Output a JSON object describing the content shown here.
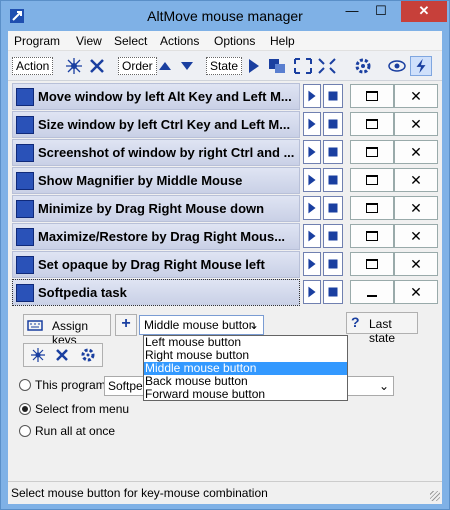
{
  "window": {
    "title": "AltMove mouse manager"
  },
  "menu": [
    "Program",
    "View",
    "Select",
    "Actions",
    "Options",
    "Help"
  ],
  "toolbar": {
    "action_label": "Action",
    "order_label": "Order",
    "state_label": "State"
  },
  "tasks": [
    {
      "label": "Move window by left Alt Key and Left M...",
      "icon": "move-window-icon"
    },
    {
      "label": "Size window by left Ctrl Key and Left M...",
      "icon": "size-window-icon"
    },
    {
      "label": "Screenshot of window by right Ctrl and ...",
      "icon": "screenshot-icon"
    },
    {
      "label": "Show Magnifier by Middle Mouse",
      "icon": "magnifier-icon"
    },
    {
      "label": "Minimize by Drag Right Mouse down",
      "icon": "minimize-icon"
    },
    {
      "label": "Maximize/Restore by Drag Right Mous...",
      "icon": "maximize-icon"
    },
    {
      "label": "Set opaque by Drag Right Mouse left",
      "icon": "eye-icon"
    },
    {
      "label": "Softpedia task",
      "icon": "window-icon"
    }
  ],
  "controls": {
    "assign_keys": "Assign keys",
    "last_state": "Last state",
    "mouse_button_selected": "Middle mouse button",
    "mouse_button_options": [
      "Left mouse button",
      "Right mouse button",
      "Middle mouse button",
      "Back mouse button",
      "Forward mouse button"
    ]
  },
  "radios": {
    "this_program": "This program",
    "select_from_menu": "Select from menu",
    "run_all": "Run all at once",
    "program_field_value": "Softpe"
  },
  "status": "Select mouse button for key-mouse combination",
  "colors": {
    "titlebar": "#7fb1e6",
    "close": "#c7403a",
    "selection": "#3399ff",
    "task_row": "#d4dbef"
  }
}
